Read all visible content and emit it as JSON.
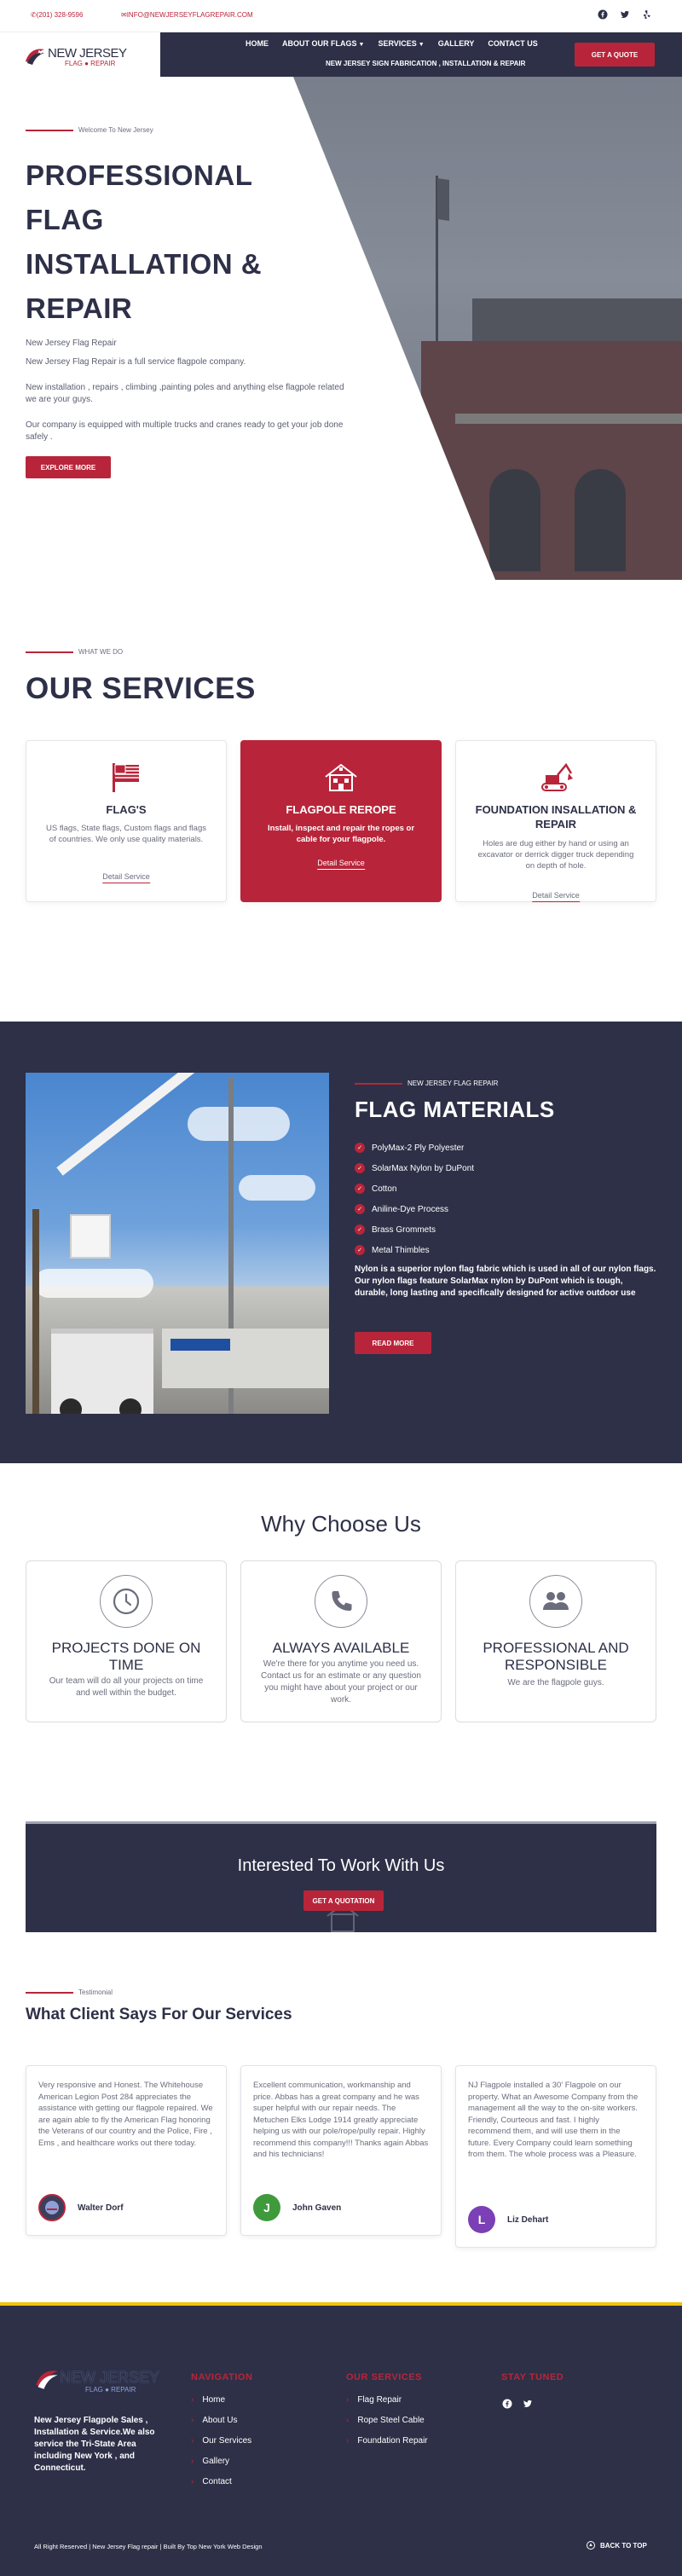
{
  "topbar": {
    "phone": "(201) 328-9596",
    "email": "INFO@NEWJERSEYFLAGREPAIR.COM",
    "socials": [
      "facebook-icon",
      "twitter-icon",
      "yelp-icon"
    ]
  },
  "logo": {
    "name": "NEW JERSEY",
    "sub": "FLAG ● REPAIR"
  },
  "nav": {
    "items": [
      "HOME",
      "ABOUT OUR FLAGS",
      "SERVICES",
      "GALLERY",
      "CONTACT US"
    ],
    "subitem": "NEW JERSEY SIGN FABRICATION , INSTALLATION & REPAIR",
    "quote": "GET A QUOTE"
  },
  "hero": {
    "eyebrow": "Welcome To New Jersey",
    "title": "PROFESSIONAL FLAG INSTALLATION & REPAIR",
    "p1": "New Jersey Flag Repair",
    "p2": "New Jersey Flag Repair is a full service flagpole company.",
    "p3": "New installation , repairs , climbing ,painting  poles and anything else flagpole related we are your guys.",
    "p4": "Our company is equipped with multiple trucks and cranes ready to get your job done safely .",
    "cta": "EXPLORE MORE"
  },
  "services": {
    "eyebrow": "WHAT WE DO",
    "title": "OUR SERVICES",
    "cards": [
      {
        "title": "FLAG'S",
        "desc": "US flags, State flags, Custom flags and flags of countries. We only use quality materials.",
        "link": "Detail Service",
        "icon": "flag-icon"
      },
      {
        "title": "FLAGPOLE REROPE",
        "desc": "Install, inspect and repair the ropes or cable for your flagpole.",
        "link": "Detail Service",
        "icon": "building-icon"
      },
      {
        "title": "FOUNDATION INSALLATION & REPAIR",
        "desc": "Holes are dug either by hand or using an excavator or derrick digger truck depending on depth of hole.",
        "link": "Detail Service",
        "icon": "excavator-icon"
      }
    ]
  },
  "materials": {
    "eyebrow": "NEW JERSEY FLAG REPAIR",
    "title": "FLAG MATERIALS",
    "items": [
      "PolyMax-2 Ply Polyester",
      "SolarMax Nylon by DuPont",
      "Cotton",
      "Aniline-Dye Process",
      "Brass Grommets",
      "Metal Thimbles"
    ],
    "desc": "Nylon is a superior nylon flag fabric which is used in all of our nylon flags. Our nylon flags feature SolarMax nylon by DuPont which is tough, durable, long lasting and specifically designed for active outdoor use",
    "cta": "READ MORE"
  },
  "why": {
    "title": "Why Choose Us",
    "cards": [
      {
        "title": "PROJECTS DONE ON TIME",
        "desc": "Our team will do all your projects on time and well within the budget.",
        "icon": "clock-icon"
      },
      {
        "title": "ALWAYS AVAILABLE",
        "desc": "We're there for you anytime you need us. Contact us for an estimate or any question you might have about your project or our work.",
        "icon": "phone-icon"
      },
      {
        "title": "PROFESSIONAL AND RESPONSIBLE",
        "desc": "We are the flagpole guys.",
        "icon": "team-icon"
      }
    ]
  },
  "banner": {
    "title": "Interested To Work With Us",
    "cta": "GET A QUOTATION"
  },
  "testimonials": {
    "eyebrow": "Testimonial",
    "title": "What Client Says For Our Services",
    "items": [
      {
        "quote": "Very responsive and Honest. The Whitehouse American Legion Post 284 appreciates the assistance with getting our flagpole repaired. We are again able to fly the American Flag honoring the Veterans of our country and the Police, Fire , Ems , and healthcare works out there today.",
        "name": "Walter Dorf",
        "initial": "",
        "color": "#3b3f5c"
      },
      {
        "quote": "Excellent communication, workmanship and price. Abbas has a great company and he was super helpful with our repair needs. The Metuchen Elks Lodge 1914 greatly appreciate helping us with our pole/rope/pully repair. Highly recommend this company!!! Thanks again Abbas and his technicians!",
        "name": "John Gaven",
        "initial": "J",
        "color": "#3f9a3c"
      },
      {
        "quote": "NJ Flagpole installed a 30' Flagpole on our property. What an Awesome Company from the management all the way to the on-site workers. Friendly, Courteous and fast. I highly recommend them, and will use them in the future. Every Company could learn something from them. The whole process was a Pleasure.",
        "name": "Liz Dehart",
        "initial": "L",
        "color": "#7b3fb6"
      }
    ]
  },
  "footer": {
    "logo_name": "NEW JERSEY",
    "logo_sub": "FLAG ● REPAIR",
    "about": "New Jersey Flagpole Sales , Installation & Service.We also service the Tri-State Area including  New York , and Connecticut.",
    "nav_title": "NAVIGATION",
    "nav": [
      "Home",
      "About Us",
      "Our Services",
      "Gallery",
      "Contact"
    ],
    "services_title": "OUR SERVICES",
    "services": [
      "Flag Repair",
      "Rope Steel Cable",
      "Foundation Repair"
    ],
    "social_title": "STAY TUNED",
    "copyright": "All Right Reserved | New Jersey Flag repair | Built By Top New York Web Design",
    "back_to_top": "BACK TO TOP"
  },
  "colors": {
    "navy": "#2d3047",
    "red": "#b8253a",
    "accent_yellow": "#f2c200"
  }
}
